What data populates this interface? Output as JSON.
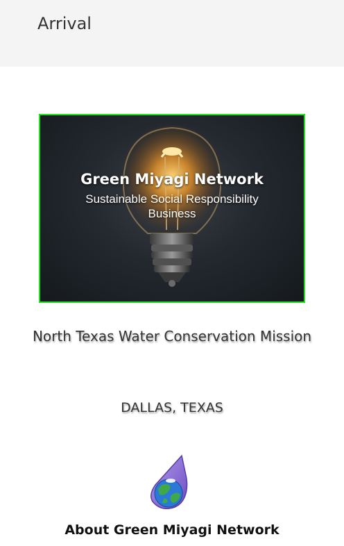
{
  "header": {
    "title": "Arrival"
  },
  "hero": {
    "heading": "Green Miyagi Network",
    "subheading": "Sustainable Social Responsibility Business",
    "image": "lightbulb-image",
    "border_color": "#1de11d"
  },
  "mission": "North Texas Water Conservation Mission",
  "location": "DALLAS, TEXAS",
  "logo": {
    "icon": "water-drop-earth-icon"
  },
  "about_heading": "About Green Miyagi Network"
}
